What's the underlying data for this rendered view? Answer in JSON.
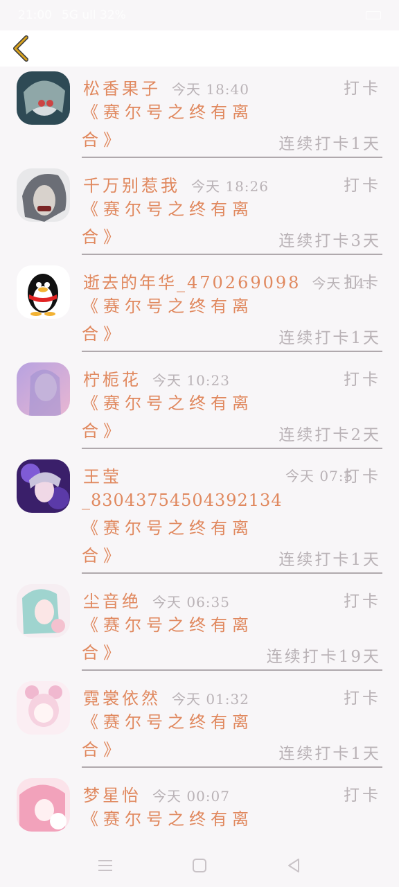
{
  "status_bar": {
    "time": "21:00",
    "signal": "5G ull 32%",
    "battery": "63"
  },
  "header": {
    "back_icon": "chevron-left-icon",
    "accent": "#d9a31e"
  },
  "colors": {
    "accent": "#e0885e",
    "muted": "#b9b2b6",
    "divider": "#b0a9ad"
  },
  "items": [
    {
      "name": "松香果子",
      "time": "今天 18:40",
      "action": "打卡",
      "book_line1": "《赛尔号之终有离",
      "book_line2": "合》",
      "streak": "连续打卡1天"
    },
    {
      "name": "千万别惹我",
      "time": "今天 18:26",
      "action": "打卡",
      "book_line1": "《赛尔号之终有离",
      "book_line2": "合》",
      "streak": "连续打卡3天"
    },
    {
      "name": "逝去的年华_470269098",
      "time": "今天 14:",
      "action": "打卡",
      "book_line1": "《赛尔号之终有离",
      "book_line2": "合》",
      "streak": "连续打卡1天"
    },
    {
      "name": "柠栀花",
      "time": "今天 10:23",
      "action": "打卡",
      "book_line1": "《赛尔号之终有离",
      "book_line2": "合》",
      "streak": "连续打卡2天"
    },
    {
      "name": "王莹",
      "name_line2": "_83043754504392134",
      "time": "今天 07:5",
      "action": "打卡",
      "book_line1": "《赛尔号之终有离",
      "book_line2": "合》",
      "streak": "连续打卡1天"
    },
    {
      "name": "尘音绝",
      "time": "今天 06:35",
      "action": "打卡",
      "book_line1": "《赛尔号之终有离",
      "book_line2": "合》",
      "streak": "连续打卡19天"
    },
    {
      "name": "霓裳依然",
      "time": "今天 01:32",
      "action": "打卡",
      "book_line1": "《赛尔号之终有离",
      "book_line2": "合》",
      "streak": "连续打卡1天"
    },
    {
      "name": "梦星怡",
      "time": "今天 00:07",
      "action": "打卡",
      "book_line1": "《赛尔号之终有离",
      "book_line2": "",
      "streak": ""
    }
  ],
  "nav_bar": {
    "menu_icon": "menu-icon",
    "home_icon": "home-icon",
    "back_icon": "back-triangle-icon"
  }
}
